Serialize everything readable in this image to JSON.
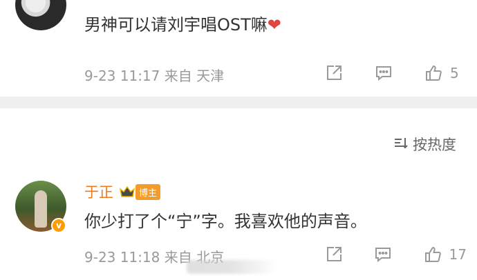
{
  "comments": [
    {
      "text": "男神可以请刘宇唱OST嘛",
      "emoji": "❤",
      "meta": "9-23 11:17  来自 天津",
      "likes": "5"
    },
    {
      "author": "于正",
      "badge": "博主",
      "verified_mark": "v",
      "text": "你少打了个“宁”字。我喜欢他的声音。",
      "meta": "9-23 11:18  来自 北京",
      "likes": "17"
    }
  ],
  "sort": {
    "label": "按热度"
  },
  "colors": {
    "author": "#ef7a1a",
    "badge_bg": "#f39c2b",
    "meta": "#999999",
    "divider": "#f0f0f0",
    "heart": "#e0463f"
  },
  "icons": [
    "share-icon",
    "comment-icon",
    "like-icon",
    "sort-icon",
    "crown-icon"
  ]
}
